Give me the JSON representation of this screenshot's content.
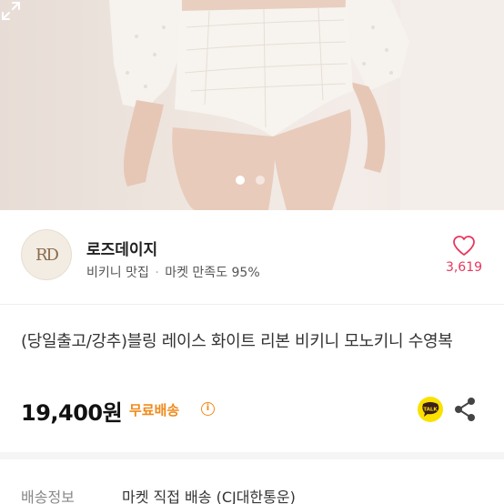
{
  "hero": {
    "image": "white-lace-bikini-product-photo",
    "page_indicator": {
      "total": 2,
      "active": 1
    },
    "expand_icon": "expand-icon"
  },
  "shop": {
    "logo_text": "RD",
    "name": "로즈데이지",
    "tag": "비키니 맛집",
    "separator": "·",
    "satisfaction": "마켓 만족도 95%",
    "like_icon": "heart-outline-icon",
    "like_count": "3,619"
  },
  "product": {
    "title": "(당일출고/강추)블링 레이스 화이트 리본 비키니 모노키니 수영복",
    "price": "19,400원",
    "shipping_badge": "무료배송",
    "info_icon_glyph": "i",
    "talk_icon": "kakao-talk-icon",
    "talk_label": "TALK",
    "share_icon": "share-icon"
  },
  "delivery": {
    "label": "배송정보",
    "value": "마켓 직접 배송 (CJ대한통운)"
  },
  "colors": {
    "like": "#e8375c",
    "free_shipping": "#f08a1c",
    "talk_bg": "#fae100"
  }
}
